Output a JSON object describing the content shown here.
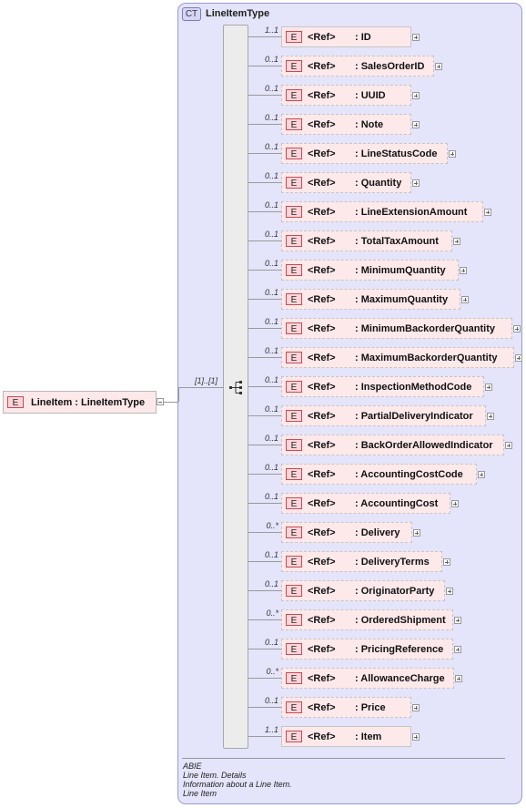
{
  "complex_type": {
    "badge": "CT",
    "name": "LineItemType"
  },
  "root": {
    "badge": "E",
    "label": "LineItem : LineItemType",
    "cardinality": "[1]..[1]"
  },
  "ref_label": "<Ref>",
  "element_badge": "E",
  "elements": [
    {
      "name": ": ID",
      "card": "1..1"
    },
    {
      "name": ": SalesOrderID",
      "card": "0..1"
    },
    {
      "name": ": UUID",
      "card": "0..1"
    },
    {
      "name": ": Note",
      "card": "0..1"
    },
    {
      "name": ": LineStatusCode",
      "card": "0..1"
    },
    {
      "name": ": Quantity",
      "card": "0..1"
    },
    {
      "name": ": LineExtensionAmount",
      "card": "0..1"
    },
    {
      "name": ": TotalTaxAmount",
      "card": "0..1"
    },
    {
      "name": ": MinimumQuantity",
      "card": "0..1"
    },
    {
      "name": ": MaximumQuantity",
      "card": "0..1"
    },
    {
      "name": ": MinimumBackorderQuantity",
      "card": "0..1"
    },
    {
      "name": ": MaximumBackorderQuantity",
      "card": "0..1"
    },
    {
      "name": ": InspectionMethodCode",
      "card": "0..1"
    },
    {
      "name": ": PartialDeliveryIndicator",
      "card": "0..1"
    },
    {
      "name": ": BackOrderAllowedIndicator",
      "card": "0..1"
    },
    {
      "name": ": AccountingCostCode",
      "card": "0..1"
    },
    {
      "name": ": AccountingCost",
      "card": "0..1"
    },
    {
      "name": ": Delivery",
      "card": "0..*"
    },
    {
      "name": ": DeliveryTerms",
      "card": "0..1"
    },
    {
      "name": ": OriginatorParty",
      "card": "0..1"
    },
    {
      "name": ": OrderedShipment",
      "card": "0..*"
    },
    {
      "name": ": PricingReference",
      "card": "0..1"
    },
    {
      "name": ": AllowanceCharge",
      "card": "0..*"
    },
    {
      "name": ": Price",
      "card": "0..1"
    },
    {
      "name": ": Item",
      "card": "1..1"
    }
  ],
  "notes": {
    "kind": "ABIE",
    "den": "Line Item. Details",
    "definition": "Information about a Line Item.",
    "term": "Line Item"
  }
}
